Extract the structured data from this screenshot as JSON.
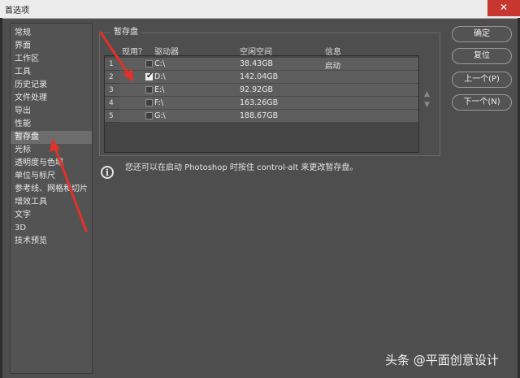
{
  "window": {
    "title": "首选项",
    "close": "✕"
  },
  "sidebar": {
    "items": [
      {
        "label": "常规"
      },
      {
        "label": "界面"
      },
      {
        "label": "工作区"
      },
      {
        "label": "工具"
      },
      {
        "label": "历史记录"
      },
      {
        "label": "文件处理"
      },
      {
        "label": "导出"
      },
      {
        "label": "性能"
      },
      {
        "label": "暂存盘",
        "selected": true
      },
      {
        "label": "光标"
      },
      {
        "label": "透明度与色域"
      },
      {
        "label": "单位与标尺"
      },
      {
        "label": "参考线、网格和切片"
      },
      {
        "label": "增效工具"
      },
      {
        "label": "文字"
      },
      {
        "label": "3D"
      },
      {
        "label": "技术预览"
      }
    ]
  },
  "scratch": {
    "group_title": "暂存盘",
    "columns": {
      "active": "现用？",
      "drive": "驱动器",
      "free": "空闲空间",
      "info": "信息"
    },
    "rows": [
      {
        "num": "1",
        "checked": false,
        "drive": "C:\\",
        "free": "38.43GB",
        "info": "启动"
      },
      {
        "num": "2",
        "checked": true,
        "drive": "D:\\",
        "free": "142.04GB",
        "info": ""
      },
      {
        "num": "3",
        "checked": false,
        "drive": "E:\\",
        "free": "92.92GB",
        "info": ""
      },
      {
        "num": "4",
        "checked": false,
        "drive": "F:\\",
        "free": "163.26GB",
        "info": ""
      },
      {
        "num": "5",
        "checked": false,
        "drive": "G:\\",
        "free": "188.67GB",
        "info": ""
      }
    ],
    "note": "您还可以在启动 Photoshop 时按住 control-alt 来更改暂存盘。",
    "info_icon": "i"
  },
  "buttons": {
    "ok": "确定",
    "reset": "复位",
    "prev": "上一个(P)",
    "next": "下一个(N)"
  },
  "icons": {
    "up": "▲",
    "down": "▼",
    "check": "✔"
  },
  "watermark": "头条 @平面创意设计",
  "colors": {
    "annotation": "#e0322a",
    "close": "#c7372f"
  }
}
